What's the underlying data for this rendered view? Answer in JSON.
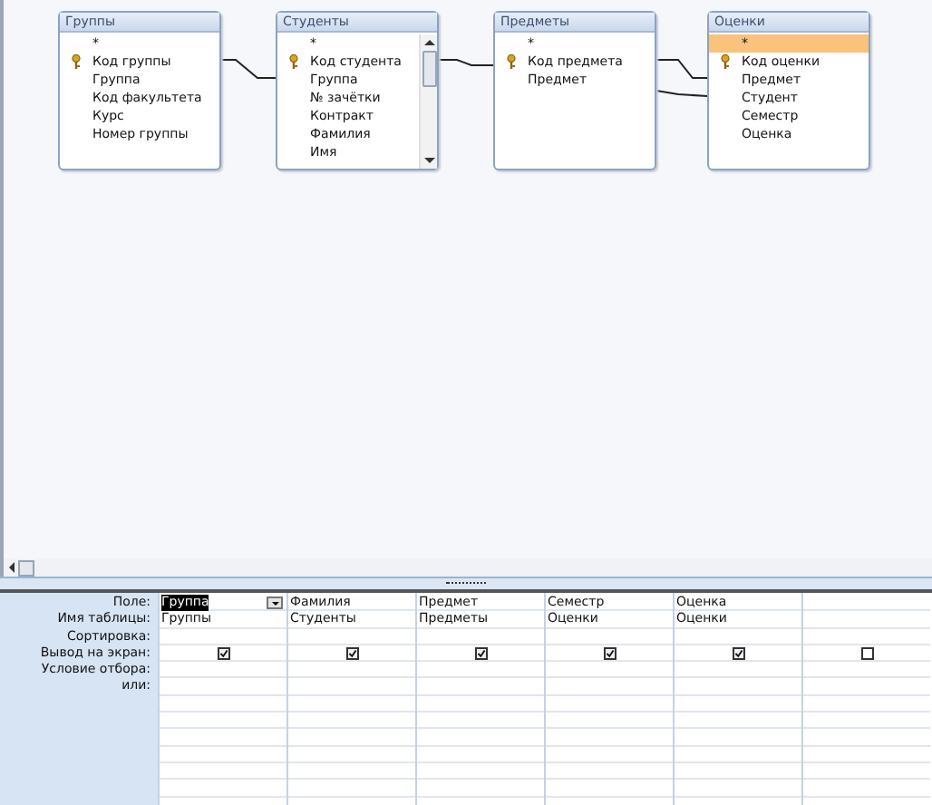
{
  "tables": [
    {
      "title": "Группы",
      "scrollbar": false,
      "fields": [
        {
          "name": "*",
          "key": false,
          "selected": false
        },
        {
          "name": "Код группы",
          "key": true,
          "selected": false
        },
        {
          "name": "Группа",
          "key": false,
          "selected": false
        },
        {
          "name": "Код факультета",
          "key": false,
          "selected": false
        },
        {
          "name": "Курс",
          "key": false,
          "selected": false
        },
        {
          "name": "Номер группы",
          "key": false,
          "selected": false
        }
      ]
    },
    {
      "title": "Студенты",
      "scrollbar": true,
      "fields": [
        {
          "name": "*",
          "key": false,
          "selected": false
        },
        {
          "name": "Код студента",
          "key": true,
          "selected": false
        },
        {
          "name": "Группа",
          "key": false,
          "selected": false
        },
        {
          "name": "№ зачётки",
          "key": false,
          "selected": false
        },
        {
          "name": "Контракт",
          "key": false,
          "selected": false
        },
        {
          "name": "Фамилия",
          "key": false,
          "selected": false
        },
        {
          "name": "Имя",
          "key": false,
          "selected": false
        }
      ]
    },
    {
      "title": "Предметы",
      "scrollbar": false,
      "fields": [
        {
          "name": "*",
          "key": false,
          "selected": false
        },
        {
          "name": "Код предмета",
          "key": true,
          "selected": false
        },
        {
          "name": "Предмет",
          "key": false,
          "selected": false
        }
      ]
    },
    {
      "title": "Оценки",
      "scrollbar": false,
      "fields": [
        {
          "name": "*",
          "key": false,
          "selected": true
        },
        {
          "name": "Код оценки",
          "key": true,
          "selected": false
        },
        {
          "name": "Предмет",
          "key": false,
          "selected": false
        },
        {
          "name": "Студент",
          "key": false,
          "selected": false
        },
        {
          "name": "Семестр",
          "key": false,
          "selected": false
        },
        {
          "name": "Оценка",
          "key": false,
          "selected": false
        }
      ]
    }
  ],
  "row_labels": [
    "Поле:",
    "Имя таблицы:",
    "Сортировка:",
    "Вывод на экран:",
    "Условие отбора:",
    "или:"
  ],
  "columns": [
    {
      "field": "Группа",
      "table": "Группы",
      "show": true,
      "selected": true
    },
    {
      "field": "Фамилия",
      "table": "Студенты",
      "show": true,
      "selected": false
    },
    {
      "field": "Предмет",
      "table": "Предметы",
      "show": true,
      "selected": false
    },
    {
      "field": "Семестр",
      "table": "Оценки",
      "show": true,
      "selected": false
    },
    {
      "field": "Оценка",
      "table": "Оценки",
      "show": true,
      "selected": false
    },
    {
      "show": false,
      "selected": false
    }
  ]
}
